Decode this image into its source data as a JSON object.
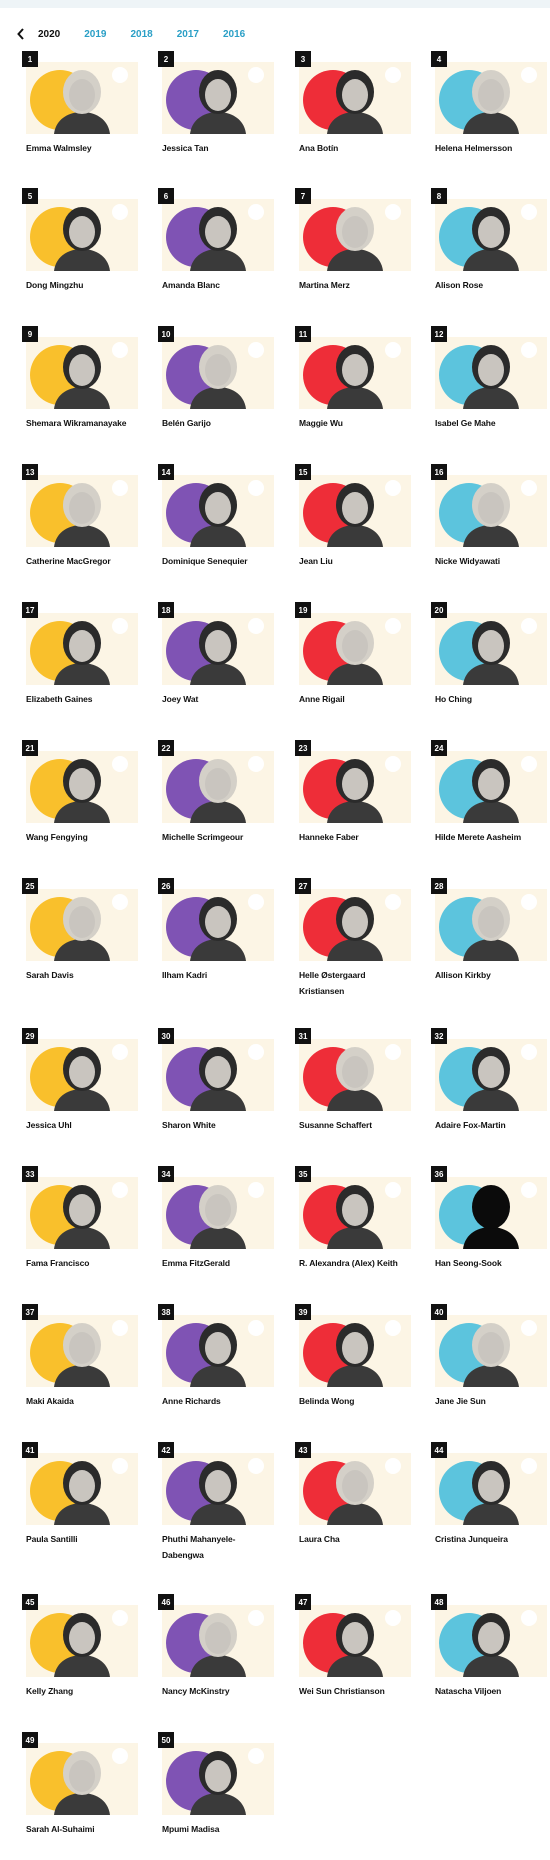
{
  "nav": {
    "back_icon": "chevron-left-icon",
    "years": [
      {
        "label": "2020",
        "active": true
      },
      {
        "label": "2019",
        "active": false
      },
      {
        "label": "2018",
        "active": false
      },
      {
        "label": "2017",
        "active": false
      },
      {
        "label": "2016",
        "active": false
      }
    ]
  },
  "colors": {
    "yellow": "#f9c02c",
    "purple": "#7f53b4",
    "red": "#ee2d38",
    "blue": "#5cc4dd",
    "tile": "#fcf5e5",
    "link": "#2a9fc6"
  },
  "people": [
    {
      "rank": "1",
      "name": "Emma Walmsley"
    },
    {
      "rank": "2",
      "name": "Jessica Tan"
    },
    {
      "rank": "3",
      "name": "Ana Botín"
    },
    {
      "rank": "4",
      "name": "Helena Helmersson"
    },
    {
      "rank": "5",
      "name": "Dong Mingzhu"
    },
    {
      "rank": "6",
      "name": "Amanda Blanc"
    },
    {
      "rank": "7",
      "name": "Martina Merz"
    },
    {
      "rank": "8",
      "name": "Alison Rose"
    },
    {
      "rank": "9",
      "name": "Shemara Wikramanayake"
    },
    {
      "rank": "10",
      "name": "Belén Garijo"
    },
    {
      "rank": "11",
      "name": "Maggie Wu"
    },
    {
      "rank": "12",
      "name": "Isabel Ge Mahe"
    },
    {
      "rank": "13",
      "name": "Catherine MacGregor"
    },
    {
      "rank": "14",
      "name": "Dominique Senequier"
    },
    {
      "rank": "15",
      "name": "Jean Liu"
    },
    {
      "rank": "16",
      "name": "Nicke Widyawati"
    },
    {
      "rank": "17",
      "name": "Elizabeth Gaines"
    },
    {
      "rank": "18",
      "name": "Joey Wat"
    },
    {
      "rank": "19",
      "name": "Anne Rigail"
    },
    {
      "rank": "20",
      "name": "Ho Ching"
    },
    {
      "rank": "21",
      "name": "Wang Fengying"
    },
    {
      "rank": "22",
      "name": "Michelle Scrimgeour"
    },
    {
      "rank": "23",
      "name": "Hanneke Faber"
    },
    {
      "rank": "24",
      "name": "Hilde Merete Aasheim"
    },
    {
      "rank": "25",
      "name": "Sarah Davis"
    },
    {
      "rank": "26",
      "name": "Ilham Kadri"
    },
    {
      "rank": "27",
      "name": "Helle Østergaard Kristiansen"
    },
    {
      "rank": "28",
      "name": "Allison Kirkby"
    },
    {
      "rank": "29",
      "name": "Jessica Uhl"
    },
    {
      "rank": "30",
      "name": "Sharon White"
    },
    {
      "rank": "31",
      "name": "Susanne Schaffert"
    },
    {
      "rank": "32",
      "name": "Adaire Fox-Martin"
    },
    {
      "rank": "33",
      "name": "Fama Francisco"
    },
    {
      "rank": "34",
      "name": "Emma FitzGerald"
    },
    {
      "rank": "35",
      "name": "R. Alexandra (Alex) Keith"
    },
    {
      "rank": "36",
      "name": "Han Seong-Sook"
    },
    {
      "rank": "37",
      "name": "Maki Akaida"
    },
    {
      "rank": "38",
      "name": "Anne Richards"
    },
    {
      "rank": "39",
      "name": "Belinda Wong"
    },
    {
      "rank": "40",
      "name": "Jane Jie Sun"
    },
    {
      "rank": "41",
      "name": "Paula Santilli"
    },
    {
      "rank": "42",
      "name": "Phuthi Mahanyele-Dabengwa"
    },
    {
      "rank": "43",
      "name": "Laura Cha"
    },
    {
      "rank": "44",
      "name": "Cristina Junqueira"
    },
    {
      "rank": "45",
      "name": "Kelly Zhang"
    },
    {
      "rank": "46",
      "name": "Nancy McKinstry"
    },
    {
      "rank": "47",
      "name": "Wei Sun Christianson"
    },
    {
      "rank": "48",
      "name": "Natascha Viljoen"
    },
    {
      "rank": "49",
      "name": "Sarah Al-Suhaimi"
    },
    {
      "rank": "50",
      "name": "Mpumi Madisa"
    }
  ]
}
